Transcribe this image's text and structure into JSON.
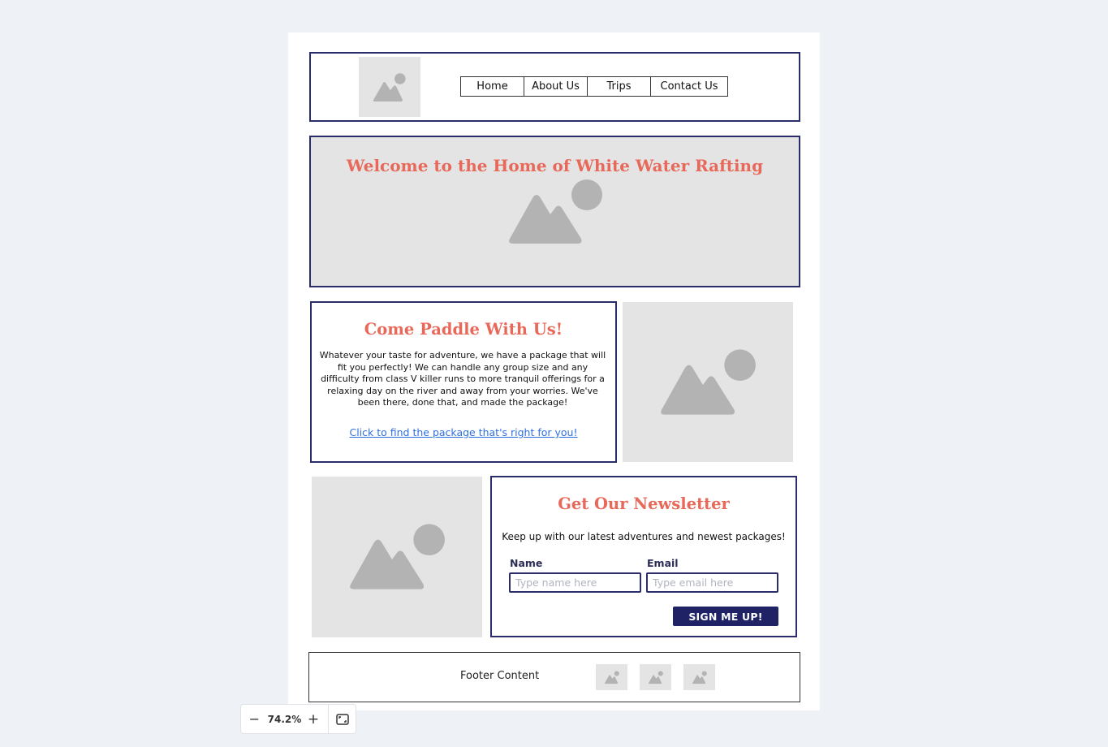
{
  "nav": {
    "items": [
      {
        "label": "Home"
      },
      {
        "label": "About Us"
      },
      {
        "label": "Trips"
      },
      {
        "label": "Contact Us"
      }
    ]
  },
  "hero": {
    "title": "Welcome to the Home of White Water Rafting"
  },
  "paddle": {
    "title": "Come Paddle With Us!",
    "body": "Whatever your taste for adventure, we have a package that will fit you perfectly! We can handle any group size and any difficulty from class V killer runs to more tranquil offerings for a relaxing day on the river and away from your worries.  We've been there, done that, and made the package!",
    "link": "Click to find the package that's right for you!"
  },
  "newsletter": {
    "title": "Get Our Newsletter",
    "subtitle": "Keep up with our latest adventures and newest packages!",
    "name_label": "Name",
    "name_placeholder": "Type name here",
    "email_label": "Email",
    "email_placeholder": "Type email here",
    "button": "SIGN ME UP!"
  },
  "footer": {
    "text": "Footer Content"
  },
  "zoom": {
    "value": "74.2%",
    "minus": "−",
    "plus": "+"
  },
  "colors": {
    "heading": "#e8695a",
    "border": "#2b2d6b",
    "button": "#1f2366",
    "link": "#2e6fe0",
    "placeholder_bg": "#e4e4e4",
    "page_bg": "#eef1f5"
  },
  "icons": {
    "image_placeholder": "image-placeholder-icon",
    "fit_screen": "fit-screen-icon"
  }
}
